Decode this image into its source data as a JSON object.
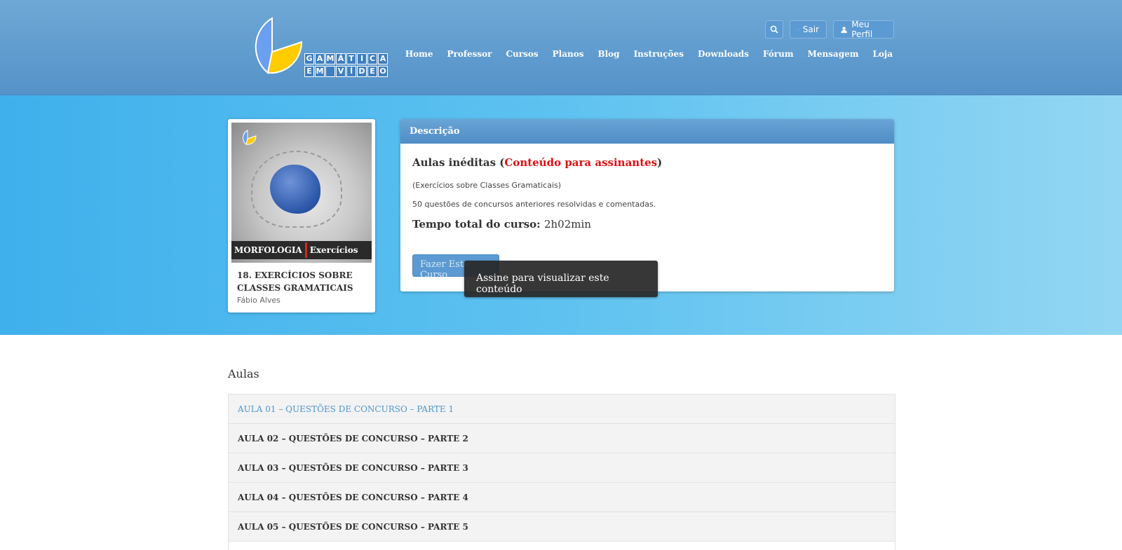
{
  "brand": {
    "logo_row1": [
      "G",
      "A",
      "M",
      "Á",
      "T",
      "I",
      "C",
      "A"
    ],
    "logo_row2": [
      "E",
      "M",
      "",
      "V",
      "Í",
      "D",
      "E",
      "O"
    ],
    "colors": {
      "blue": "#6b9ff0",
      "yellow": "#ffcc00"
    }
  },
  "header": {
    "search_icon": "search-icon",
    "logout_label": "Sair",
    "profile_label": "Meu Perfil"
  },
  "nav": {
    "items": [
      {
        "label": "Home"
      },
      {
        "label": "Professor"
      },
      {
        "label": "Cursos"
      },
      {
        "label": "Planos"
      },
      {
        "label": "Blog"
      },
      {
        "label": "Instruções"
      },
      {
        "label": "Downloads"
      },
      {
        "label": "Fórum"
      },
      {
        "label": "Mensagem"
      },
      {
        "label": "Loja"
      }
    ]
  },
  "course": {
    "banner_left": "MORFOLOGIA",
    "banner_right": "Exercícios",
    "title": "18. EXERCÍCIOS SOBRE CLASSES GRAMATICAIS",
    "author": "Fábio Alves"
  },
  "description": {
    "header": "Descrição",
    "heading_prefix": "Aulas inéditas (",
    "heading_highlight": "Conteúdo para assinantes",
    "heading_suffix": ")",
    "subtitle": "(Exercícios sobre Classes Gramaticais)",
    "questions": "50 questões de concursos anteriores resolvidas e comentadas.",
    "time_label": "Tempo total do curso:",
    "time_value": "2h02min",
    "enroll_label": "Fazer Este Curso",
    "tooltip": "Assine para visualizar este conteúdo"
  },
  "lessons": {
    "title": "Aulas",
    "items": [
      {
        "label": "AULA 01 – QUESTÕES DE CONCURSO – PARTE 1"
      },
      {
        "label": "AULA 02 – QUESTÕES DE CONCURSO – PARTE 2"
      },
      {
        "label": "AULA 03 – QUESTÕES DE CONCURSO – PARTE 3"
      },
      {
        "label": "AULA 04 – QUESTÕES DE CONCURSO – PARTE 4"
      },
      {
        "label": "AULA 05 – QUESTÕES DE CONCURSO – PARTE 5"
      }
    ]
  }
}
